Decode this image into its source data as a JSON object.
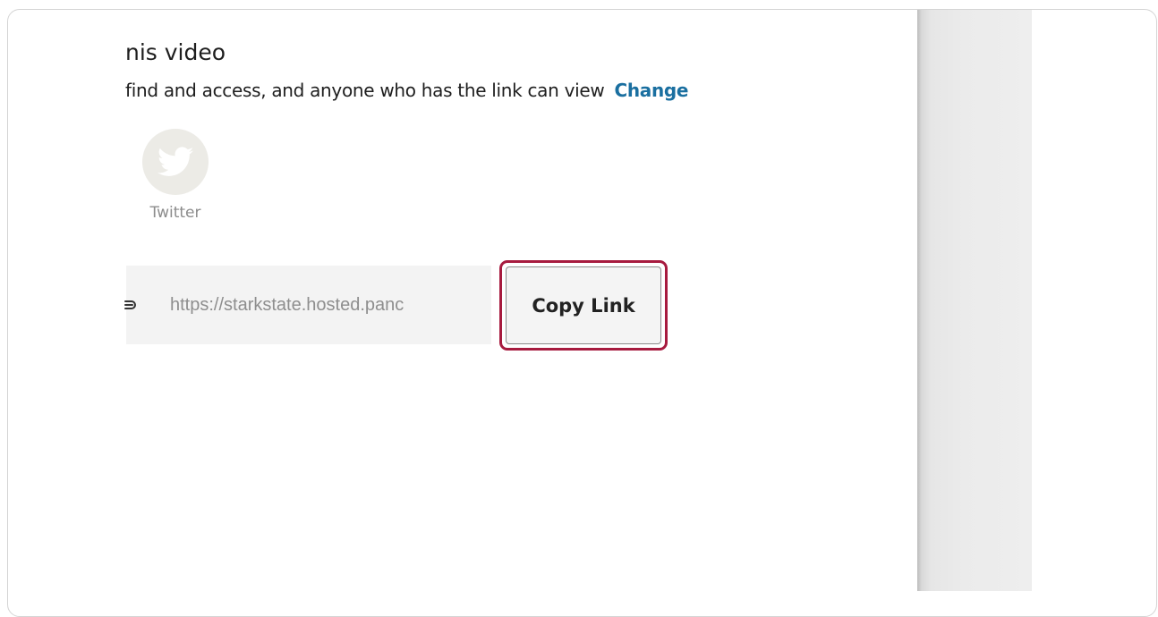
{
  "dialog": {
    "title": "nis video",
    "description": "find and access, and anyone who has the link can view",
    "change_label": "Change"
  },
  "share_targets": [
    {
      "label": "Twitter",
      "icon": "twitter-icon"
    }
  ],
  "link": {
    "value": "https://starkstate.hosted.panc",
    "icon": "link-icon"
  },
  "actions": {
    "copy_label": "Copy Link"
  },
  "colors": {
    "accent_link": "#1a6fa0",
    "highlight_border": "#a71b3f",
    "share_circle_bg": "#ecebe6"
  }
}
